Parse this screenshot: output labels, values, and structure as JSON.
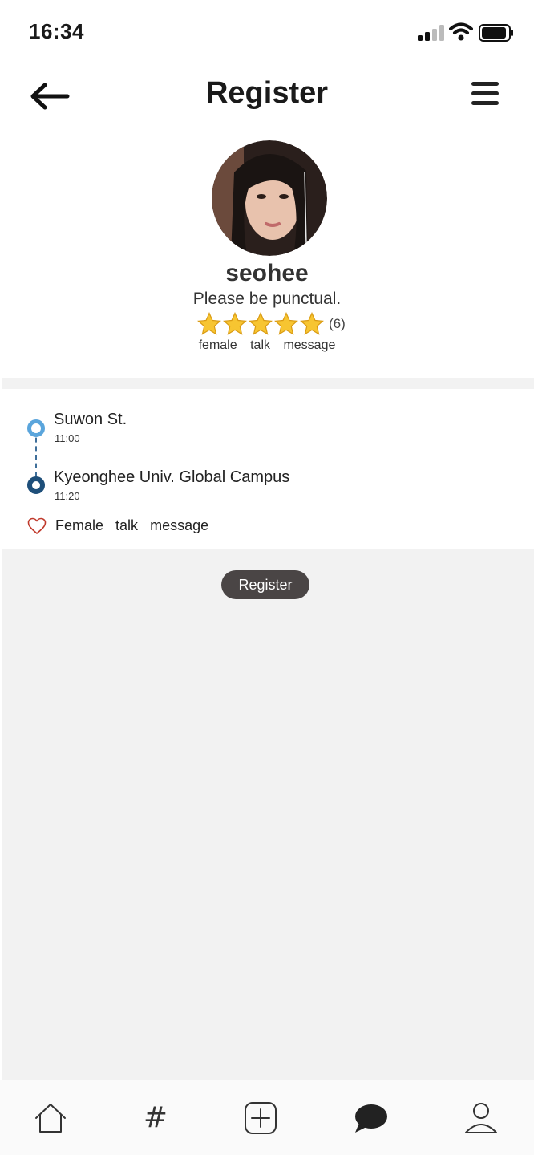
{
  "status_bar": {
    "time": "16:34"
  },
  "header": {
    "title": "Register"
  },
  "profile": {
    "username": "seohee",
    "bio": "Please be punctual.",
    "rating_stars": 5,
    "rating_count": "(6)",
    "tags": [
      "female",
      "talk",
      "message"
    ]
  },
  "route": {
    "start_name": "Suwon St.",
    "start_time": "11:00",
    "end_name": "Kyeonghee Univ. Global Campus",
    "end_time": "11:20",
    "tags": [
      "Female",
      "talk",
      "message"
    ]
  },
  "actions": {
    "register_label": "Register"
  },
  "colors": {
    "accent_dark": "#4a4545",
    "route_start": "#5aa5dc",
    "route_end": "#1e4f7a",
    "star": "#f7c531",
    "heart": "#c0392b",
    "background_gray": "#f2f2f2"
  },
  "icons": {
    "back": "back-arrow-icon",
    "menu": "hamburger-menu-icon",
    "like": "heart-icon",
    "tab_home": "home-icon",
    "tab_tags": "hashtag-icon",
    "tab_add": "plus-square-icon",
    "tab_chat": "chat-bubble-icon",
    "tab_profile": "person-icon"
  },
  "tabbar": {
    "hash_glyph": "#"
  }
}
